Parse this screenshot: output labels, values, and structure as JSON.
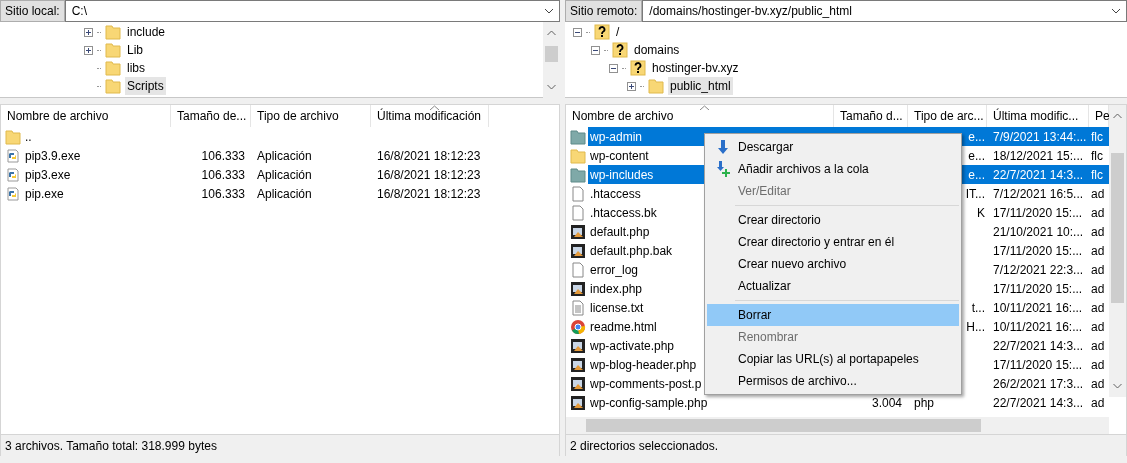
{
  "local": {
    "label": "Sitio local:",
    "path": "C:\\",
    "tree": [
      {
        "name": "include",
        "has_children": true,
        "selected": false
      },
      {
        "name": "Lib",
        "has_children": true,
        "selected": false
      },
      {
        "name": "libs",
        "has_children": false,
        "selected": false
      },
      {
        "name": "Scripts",
        "has_children": false,
        "selected": true
      }
    ],
    "columns": [
      {
        "label": "Nombre de archivo",
        "sorted": false
      },
      {
        "label": "Tamaño de...",
        "sorted": false
      },
      {
        "label": "Tipo de archivo",
        "sorted": false
      },
      {
        "label": "Última modificación",
        "sorted": true
      }
    ],
    "rows": [
      {
        "kind": "folder",
        "name": "..",
        "selected": false
      },
      {
        "kind": "python",
        "name": "pip3.9.exe",
        "size": "106.333",
        "type": "Aplicación",
        "modified": "16/8/2021 18:12:23",
        "selected": false
      },
      {
        "kind": "python",
        "name": "pip3.exe",
        "size": "106.333",
        "type": "Aplicación",
        "modified": "16/8/2021 18:12:23",
        "selected": false
      },
      {
        "kind": "python",
        "name": "pip.exe",
        "size": "106.333",
        "type": "Aplicación",
        "modified": "16/8/2021 18:12:23",
        "selected": false
      }
    ],
    "status": "3 archivos. Tamaño total: 318.999 bytes"
  },
  "remote": {
    "label": "Sitio remoto:",
    "path": "/domains/hostinger-bv.xyz/public_html",
    "tree": [
      {
        "name": "/",
        "kind": "unknown",
        "expanded": true,
        "selected": false,
        "children": [
          {
            "name": "domains",
            "kind": "unknown",
            "expanded": true,
            "selected": false,
            "children": [
              {
                "name": "hostinger-bv.xyz",
                "kind": "unknown",
                "expanded": true,
                "selected": false,
                "children": [
                  {
                    "name": "public_html",
                    "kind": "folder",
                    "expanded": false,
                    "selected": true
                  }
                ]
              }
            ]
          }
        ]
      }
    ],
    "columns": [
      {
        "label": "Nombre de archivo",
        "sorted": true
      },
      {
        "label": "Tamaño d...",
        "sorted": false
      },
      {
        "label": "Tipo de arc...",
        "sorted": false
      },
      {
        "label": "Última modific...",
        "sorted": false
      },
      {
        "label": "Pe",
        "sorted": false
      }
    ],
    "rows": [
      {
        "kind": "folder",
        "name": "wp-admin",
        "type": "e...",
        "type_cut": true,
        "modified": "7/9/2021 13:44:...",
        "perms": "flc",
        "selected": true
      },
      {
        "kind": "folder",
        "name": "wp-content",
        "type": "e...",
        "type_cut": true,
        "modified": "18/12/2021 15:...",
        "perms": "flc",
        "selected": false
      },
      {
        "kind": "folder",
        "name": "wp-includes",
        "type": "e...",
        "type_cut": true,
        "modified": "22/7/2021 14:3...",
        "perms": "flc",
        "selected": true
      },
      {
        "kind": "file",
        "name": ".htaccess",
        "type": "IT...",
        "type_cut": true,
        "modified": "7/12/2021 16:5...",
        "perms": "ad",
        "selected": false
      },
      {
        "kind": "file",
        "name": ".htaccess.bk",
        "type": "K",
        "type_cut": true,
        "modified": "17/11/2020 15:...",
        "perms": "ad",
        "selected": false
      },
      {
        "kind": "php",
        "name": "default.php",
        "modified": "21/10/2021 10:...",
        "perms": "ad",
        "selected": false
      },
      {
        "kind": "php",
        "name": "default.php.bak",
        "modified": "17/11/2020 15:...",
        "perms": "ad",
        "selected": false
      },
      {
        "kind": "file",
        "name": "error_log",
        "modified": "7/12/2021 22:3...",
        "perms": "ad",
        "selected": false
      },
      {
        "kind": "php",
        "name": "index.php",
        "modified": "17/11/2020 15:...",
        "perms": "ad",
        "selected": false
      },
      {
        "kind": "text",
        "name": "license.txt",
        "type": "t...",
        "type_cut": true,
        "modified": "10/11/2021 16:...",
        "perms": "ad",
        "selected": false
      },
      {
        "kind": "chrome",
        "name": "readme.html",
        "type": "H...",
        "type_cut": true,
        "modified": "10/11/2021 16:...",
        "perms": "ad",
        "selected": false
      },
      {
        "kind": "php",
        "name": "wp-activate.php",
        "modified": "22/7/2021 14:3...",
        "perms": "ad",
        "selected": false
      },
      {
        "kind": "php",
        "name": "wp-blog-header.php",
        "modified": "17/11/2020 15:...",
        "perms": "ad",
        "selected": false
      },
      {
        "kind": "php",
        "name": "wp-comments-post.p",
        "modified": "26/2/2021 17:3...",
        "perms": "ad",
        "selected": false
      },
      {
        "kind": "php",
        "name": "wp-config-sample.php",
        "size": "3.004",
        "type": "php",
        "type_cut": false,
        "modified": "22/7/2021 14:3...",
        "perms": "ad",
        "selected": false
      }
    ],
    "status": "2 directorios seleccionados."
  },
  "context_menu": [
    {
      "kind": "download",
      "label": "Descargar",
      "disabled": false,
      "selected": false
    },
    {
      "kind": "queue",
      "label": "Añadir archivos a la cola",
      "disabled": false,
      "selected": false
    },
    {
      "kind": "item",
      "label": "Ver/Editar",
      "disabled": true,
      "selected": false
    },
    {
      "kind": "separator"
    },
    {
      "kind": "item",
      "label": "Crear directorio",
      "disabled": false,
      "selected": false
    },
    {
      "kind": "item",
      "label": "Crear directorio y entrar en él",
      "disabled": false,
      "selected": false
    },
    {
      "kind": "item",
      "label": "Crear nuevo archivo",
      "disabled": false,
      "selected": false
    },
    {
      "kind": "item",
      "label": "Actualizar",
      "disabled": false,
      "selected": false
    },
    {
      "kind": "separator"
    },
    {
      "kind": "item",
      "label": "Borrar",
      "disabled": false,
      "selected": true
    },
    {
      "kind": "item",
      "label": "Renombrar",
      "disabled": true,
      "selected": false
    },
    {
      "kind": "item",
      "label": "Copiar las URL(s) al portapapeles",
      "disabled": false,
      "selected": false
    },
    {
      "kind": "item",
      "label": "Permisos de archivo...",
      "disabled": false,
      "selected": false
    }
  ]
}
